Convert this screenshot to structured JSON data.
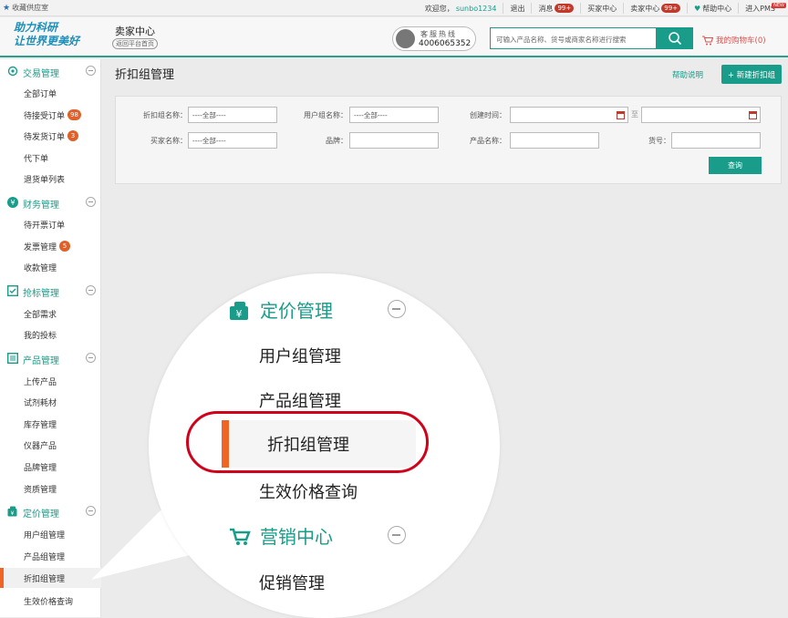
{
  "topbar": {
    "favorite": "收藏供应室",
    "greeting": "欢迎您，",
    "username": "sunbo1234",
    "logout": "退出",
    "messages": "消息",
    "messages_badge": "99+",
    "buyer_center": "买家中心",
    "seller_center": "卖家中心",
    "seller_badge": "99+",
    "help_center": "帮助中心",
    "pms": "进入PMS",
    "pms_badge": "NEW"
  },
  "header": {
    "logo_line1": "助力科研",
    "logo_line2": "让世界更美好",
    "center_title": "卖家中心",
    "back_home": "返回平台首页",
    "hotline_label": "客服热线",
    "hotline_number": "4006065352",
    "search_placeholder": "可输入产品名称、货号或商家名称进行搜索",
    "cart": "我的购物车(0)"
  },
  "sidebar": {
    "sections": [
      {
        "title": "交易管理",
        "icon": "gear-icon",
        "items": [
          {
            "label": "全部订单"
          },
          {
            "label": "待接受订单",
            "badge": "98"
          },
          {
            "label": "待发货订单",
            "badge": "3"
          },
          {
            "label": "代下单"
          },
          {
            "label": "退货单列表"
          }
        ]
      },
      {
        "title": "财务管理",
        "icon": "yen-icon",
        "items": [
          {
            "label": "待开票订单"
          },
          {
            "label": "发票管理",
            "badge": "5"
          },
          {
            "label": "收款管理"
          }
        ]
      },
      {
        "title": "抢标管理",
        "icon": "checkbox-icon",
        "items": [
          {
            "label": "全部需求"
          },
          {
            "label": "我的投标"
          }
        ]
      },
      {
        "title": "产品管理",
        "icon": "list-icon",
        "items": [
          {
            "label": "上传产品"
          },
          {
            "label": "试剂耗材"
          },
          {
            "label": "库存管理"
          },
          {
            "label": "仪器产品"
          },
          {
            "label": "品牌管理"
          },
          {
            "label": "资质管理"
          }
        ]
      },
      {
        "title": "定价管理",
        "icon": "price-tag-icon",
        "items": [
          {
            "label": "用户组管理"
          },
          {
            "label": "产品组管理"
          },
          {
            "label": "折扣组管理"
          },
          {
            "label": "生效价格查询"
          }
        ]
      }
    ]
  },
  "main": {
    "title": "折扣组管理",
    "help": "帮助说明",
    "new_button": "+ 新建折扣组"
  },
  "filter": {
    "discount_group_label": "折扣组名称：",
    "discount_group_value": "----全部----",
    "user_group_label": "用户组名称：",
    "user_group_value": "----全部----",
    "created_label": "创建时间：",
    "to": "至",
    "buyer_label": "买家名称：",
    "buyer_value": "----全部----",
    "brand_label": "品牌：",
    "product_label": "产品名称：",
    "sku_label": "货号：",
    "query_button": "查询"
  },
  "magnifier": {
    "pricing_title": "定价管理",
    "user_group": "用户组管理",
    "product_group": "产品组管理",
    "discount_group": "折扣组管理",
    "effective_price": "生效价格查询",
    "marketing_title": "营销中心",
    "promotion": "促销管理"
  },
  "colors": {
    "accent": "#1a9c8a",
    "active_marker": "#f06424",
    "highlight_ring": "#d0021b",
    "badge": "#e0602a"
  }
}
